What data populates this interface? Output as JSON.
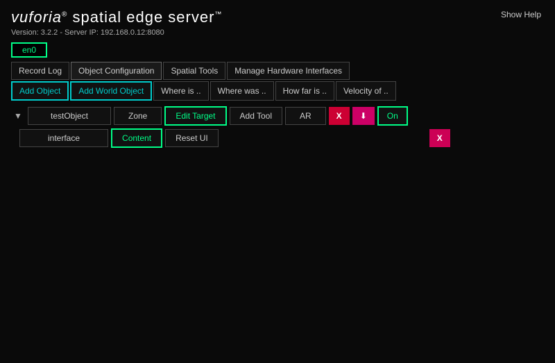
{
  "header": {
    "logo": "vuforia® spatial edge server™",
    "logo_plain": "vuforia",
    "logo_rest": " spatial edge server",
    "version_text": "Version: 3.2.2 - Server IP: 192.168.0.12:8080",
    "show_help": "Show Help"
  },
  "network": {
    "en0_label": "en0"
  },
  "toolbar_row1": {
    "record_log": "Record Log",
    "object_config": "Object Configuration",
    "spatial_tools": "Spatial Tools",
    "manage_hw": "Manage Hardware Interfaces"
  },
  "toolbar_row2": {
    "add_object": "Add Object",
    "add_world_object": "Add World Object",
    "where_is": "Where is ..",
    "where_was": "Where was ..",
    "how_far": "How far is ..",
    "velocity": "Velocity of .."
  },
  "object_row": {
    "triangle": "▼",
    "test_object": "testObject",
    "zone": "Zone",
    "edit_target": "Edit Target",
    "add_tool": "Add Tool",
    "ar": "AR",
    "x1": "X",
    "on": "On"
  },
  "object_row2": {
    "interface": "interface",
    "content": "Content",
    "reset_ui": "Reset UI",
    "x2": "X"
  },
  "icons": {
    "download": "⬇"
  }
}
